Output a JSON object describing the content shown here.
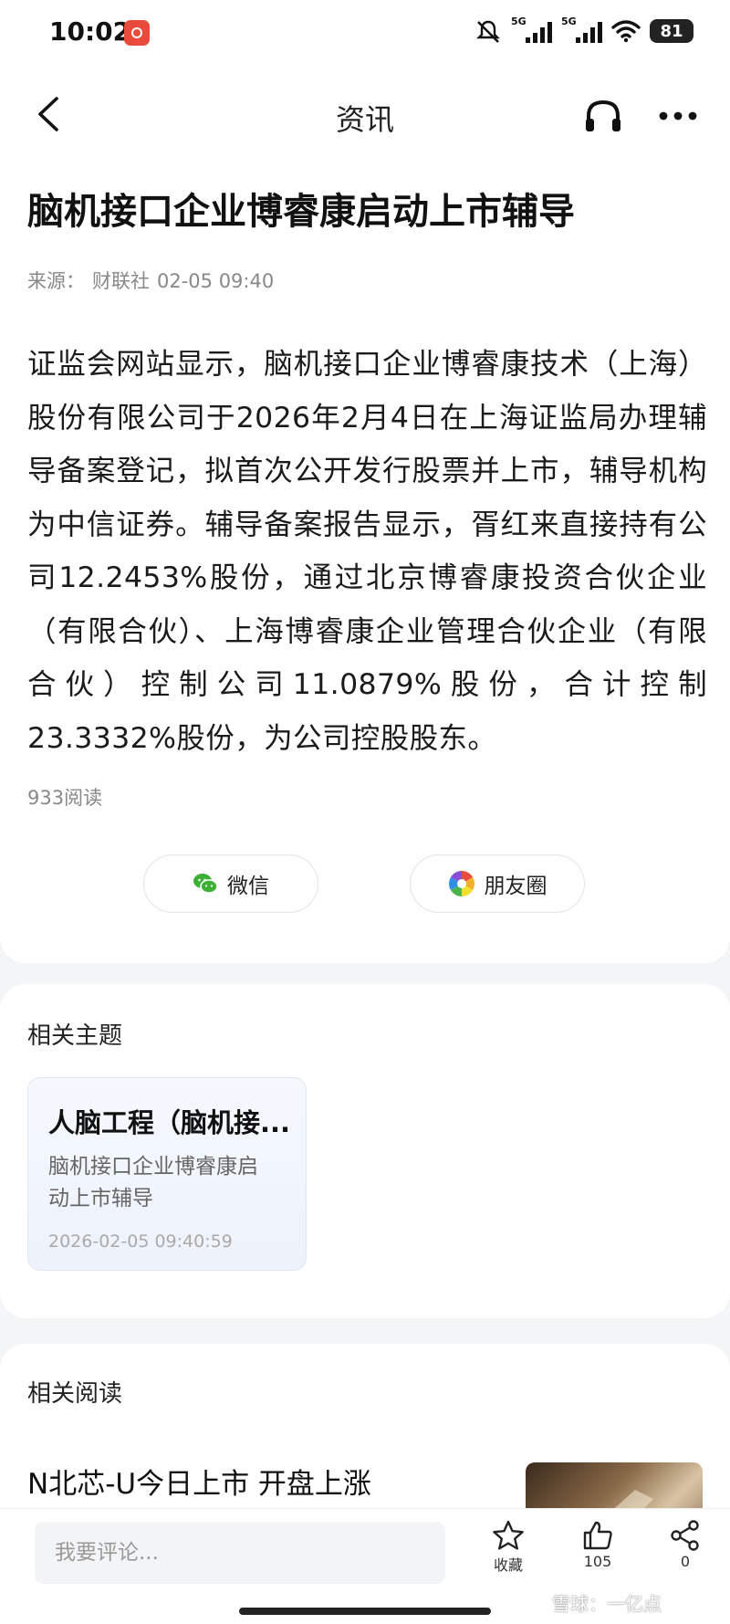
{
  "status_bar": {
    "time": "10:02",
    "signal_tag": "5G",
    "battery": "81"
  },
  "nav": {
    "title": "资讯"
  },
  "article": {
    "headline": "脑机接口企业博睿康启动上市辅导",
    "source_label": "来源：",
    "source_name": "财联社",
    "time": "02-05 09:40",
    "body": "证监会网站显示，脑机接口企业博睿康技术（上海）股份有限公司于2026年2月4日在上海证监局办理辅导备案登记，拟首次公开发行股票并上市，辅导机构为中信证券。辅导备案报告显示，胥红来直接持有公司12.2453%股份，通过北京博睿康投资合伙企业（有限合伙）、上海博睿康企业管理合伙企业（有限合伙）控制公司11.0879%股份，合计控制23.3332%股份，为公司控股股东。",
    "read_count": "933阅读",
    "share_wechat": "微信",
    "share_moments": "朋友圈"
  },
  "topics": {
    "section_title": "相关主题",
    "items": [
      {
        "title": "人脑工程（脑机接...",
        "desc": "脑机接口企业博睿康启动上市辅导",
        "time": "2026-02-05 09:40:59"
      }
    ]
  },
  "related": {
    "section_title": "相关阅读",
    "items": [
      {
        "title": "N北芯-U今日上市 开盘上涨"
      }
    ]
  },
  "bottom": {
    "comment_placeholder": "我要评论...",
    "favorite_label": "收藏",
    "like_count": "105",
    "share_count": "0",
    "watermark": "雪球：一亿点"
  },
  "colors": {
    "wechat_green": "#3cb035",
    "accent_red": "#e84a3b"
  },
  "icons": [
    "back-icon",
    "headphones-icon",
    "more-icon",
    "wechat-icon",
    "moments-icon",
    "star-icon",
    "thumb-up-icon",
    "share-icon"
  ]
}
